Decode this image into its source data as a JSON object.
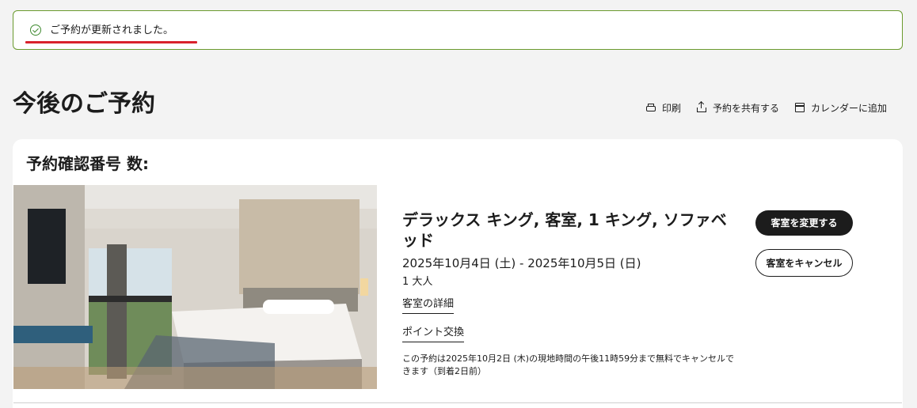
{
  "alert": {
    "message": "ご予約が更新されました。",
    "icon": "check-circle-icon",
    "color": "#3f8a2f"
  },
  "page": {
    "title": "今後のご予約"
  },
  "actions": {
    "print": {
      "label": "印刷",
      "icon": "printer-icon"
    },
    "share": {
      "label": "予約を共有する",
      "icon": "share-icon"
    },
    "calendar": {
      "label": "カレンダーに追加",
      "icon": "calendar-add-icon"
    }
  },
  "reservation": {
    "heading": "予約確認番号 数:",
    "room_title": "デラックス キング, 客室, 1 キング, ソファベッド",
    "dates": "2025年10月4日 (土) - 2025年10月5日 (日)",
    "guests": "1 大人",
    "details_link": "客室の詳細",
    "points_link": "ポイント交換",
    "cancel_note": "この予約は2025年10月2日 (木)の現地時間の午後11時59分まで無料でキャンセルできます（到着2日前）",
    "change_button": "客室を変更する",
    "cancel_button": "客室をキャンセル"
  },
  "colors": {
    "accent_underline": "#d9212c",
    "primary_button": "#1c1c1c",
    "background": "#f3f3f3"
  }
}
